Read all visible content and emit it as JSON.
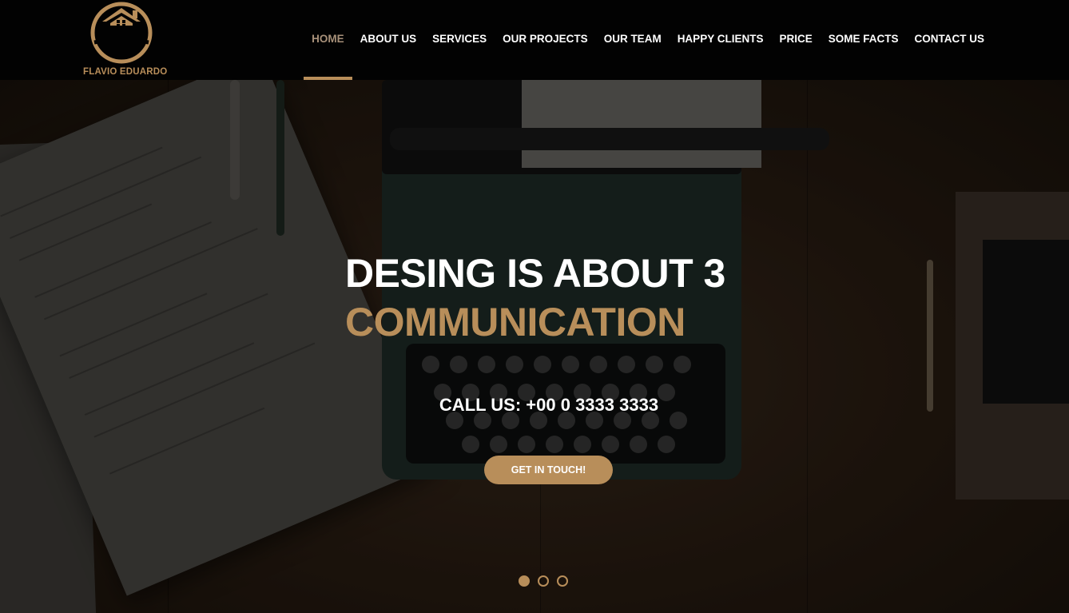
{
  "brand": {
    "name": "FLAVIO EDUARDO",
    "accent_color": "#b88e5a",
    "logo_icon": "house-in-circle-icon"
  },
  "nav": {
    "items": [
      {
        "label": "HOME",
        "active": true
      },
      {
        "label": "ABOUT US",
        "active": false
      },
      {
        "label": "SERVICES",
        "active": false
      },
      {
        "label": "OUR PROJECTS",
        "active": false
      },
      {
        "label": "OUR TEAM",
        "active": false
      },
      {
        "label": "HAPPY CLIENTS",
        "active": false
      },
      {
        "label": "PRICE",
        "active": false
      },
      {
        "label": "SOME FACTS",
        "active": false
      },
      {
        "label": "CONTACT US",
        "active": false
      }
    ]
  },
  "hero": {
    "title": "DESING IS ABOUT 3",
    "subtitle": "COMMUNICATION",
    "call": "CALL US: +00 0 3333 3333",
    "cta_label": "GET IN TOUCH!",
    "slider": {
      "count": 3,
      "active_index": 0
    }
  }
}
